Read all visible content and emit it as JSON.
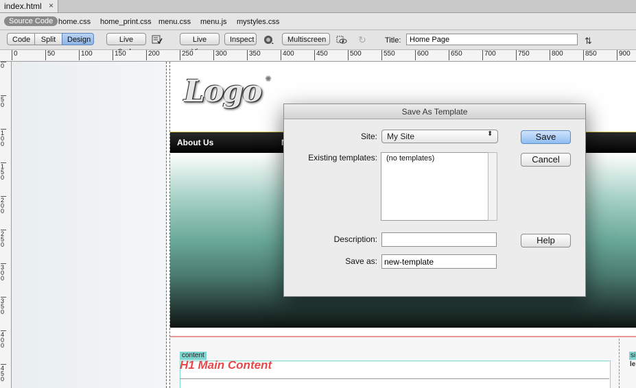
{
  "document_tab": {
    "title": "index.html",
    "close_glyph": "×"
  },
  "related_files": {
    "source_code": "Source Code",
    "files": [
      "home.css",
      "home_print.css",
      "menu.css",
      "menu.js",
      "mystyles.css"
    ]
  },
  "toolbar": {
    "view_buttons": [
      "Code",
      "Split",
      "Design"
    ],
    "active_view": "Design",
    "live_code": "Live Code",
    "live_view": "Live View",
    "inspect": "Inspect",
    "multiscreen": "Multiscreen",
    "title_label": "Title:",
    "title_value": "Home Page",
    "icons": [
      "check-page-icon",
      "browser-preview-icon",
      "visual-aids-icon",
      "refresh-icon",
      "file-transfer-icon"
    ]
  },
  "ruler": {
    "h_labels": [
      "0",
      "50",
      "100",
      "150",
      "200",
      "250",
      "300",
      "350",
      "400",
      "450",
      "500",
      "550",
      "600",
      "650",
      "700",
      "750",
      "800",
      "850",
      "900"
    ],
    "v_labels": [
      "0",
      "50",
      "100",
      "150",
      "200",
      "250",
      "300",
      "350",
      "400",
      "450"
    ]
  },
  "page": {
    "logo_text": "Logo",
    "nav_items": [
      "About Us",
      "N"
    ],
    "content_tag": "content",
    "h1": "H1 Main Content",
    "sidebar_tag": "si",
    "sidebar_text": "le"
  },
  "dialog": {
    "title": "Save As Template",
    "site_label": "Site:",
    "site_value": "My Site",
    "existing_label": "Existing templates:",
    "existing_items": [
      "(no templates)"
    ],
    "description_label": "Description:",
    "description_value": "",
    "save_as_label": "Save as:",
    "save_as_value": "new-template",
    "buttons": {
      "save": "Save",
      "cancel": "Cancel",
      "help": "Help"
    }
  },
  "colors": {
    "accent": "#8fb4e6",
    "h1": "#e8484a",
    "nav_border": "#d3c84b",
    "tag": "#7fd6d0"
  }
}
